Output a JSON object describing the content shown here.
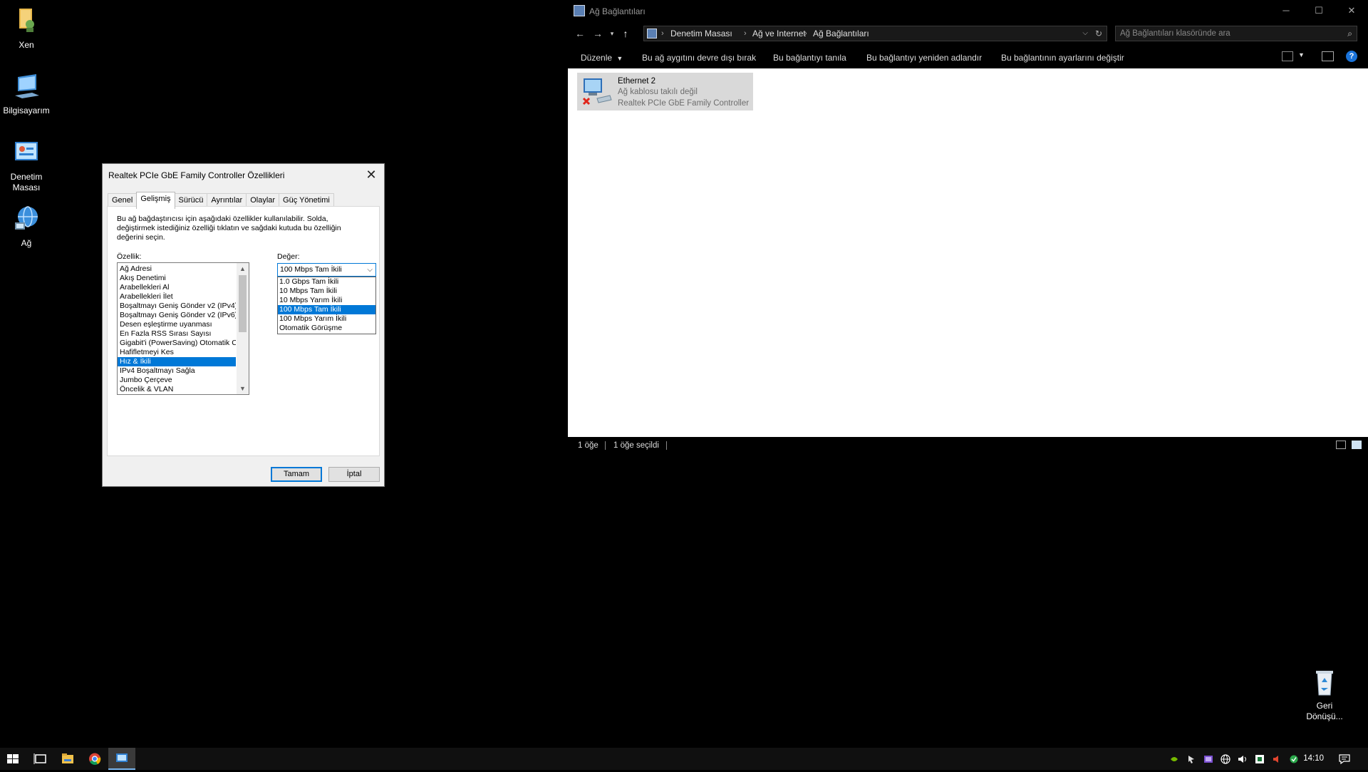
{
  "desktop": {
    "icons": [
      {
        "label": "Xen"
      },
      {
        "label": "Bilgisayarım"
      },
      {
        "label": "Denetim Masası"
      },
      {
        "label": "Ağ"
      },
      {
        "label": "Geri Dönüşü..."
      }
    ]
  },
  "dialog": {
    "title": "Realtek PCIe GbE Family Controller Özellikleri",
    "tabs": [
      "Genel",
      "Gelişmiş",
      "Sürücü",
      "Ayrıntılar",
      "Olaylar",
      "Güç Yönetimi"
    ],
    "active_tab": "Gelişmiş",
    "description": "Bu ağ bağdaştırıcısı için aşağıdaki özellikler kullanılabilir. Solda, değiştirmek istediğiniz özelliği tıklatın ve sağdaki kutuda bu özelliğin değerini seçin.",
    "property_label": "Özellik:",
    "value_label": "Değer:",
    "properties": [
      "Ağ Adresi",
      "Akış Denetimi",
      "Arabellekleri Al",
      "Arabellekleri İlet",
      "Boşaltmayı Geniş Gönder v2 (IPv4)",
      "Boşaltmayı Geniş Gönder v2 (IPv6)",
      "Desen eşleştirme uyanması",
      "En Fazla RSS Sırası Sayısı",
      "Gigabit'i (PowerSaving) Otomatik C",
      "Hafifletmeyi Kes",
      "Hız & İkili",
      "IPv4 Boşaltmayı Sağla",
      "Jumbo Çerçeve",
      "Öncelik & VLAN"
    ],
    "selected_property": "Hız & İkili",
    "value_selected": "100 Mbps Tam İkili",
    "value_options": [
      "1.0 Gbps Tam İkili",
      "10 Mbps Tam İkili",
      "10 Mbps Yarım İkili",
      "100 Mbps Tam İkili",
      "100 Mbps Yarım İkili",
      "Otomatik Görüşme"
    ],
    "ok_label": "Tamam",
    "cancel_label": "İptal"
  },
  "explorer": {
    "title": "Ağ Bağlantıları",
    "breadcrumb": [
      "Denetim Masası",
      "Ağ ve Internet",
      "Ağ Bağlantıları"
    ],
    "search_placeholder": "Ağ Bağlantıları klasöründe ara",
    "commands": [
      "Düzenle",
      "Bu ağ aygıtını devre dışı bırak",
      "Bu bağlantıyı tanıla",
      "Bu bağlantıyı yeniden adlandır",
      "Bu bağlantının ayarlarını değiştir"
    ],
    "connection": {
      "name": "Ethernet 2",
      "status": "Ağ kablosu takılı değil",
      "device": "Realtek PCIe GbE Family Controller"
    },
    "status": {
      "count": "1 öğe",
      "selected": "1 öğe seçildi"
    }
  },
  "taskbar": {
    "clock": "14:10"
  },
  "colors": {
    "accent": "#0078d7",
    "desktop_bg": "#000000",
    "taskbar_bg": "#101010",
    "selection_tile": "#d9d9d9"
  }
}
